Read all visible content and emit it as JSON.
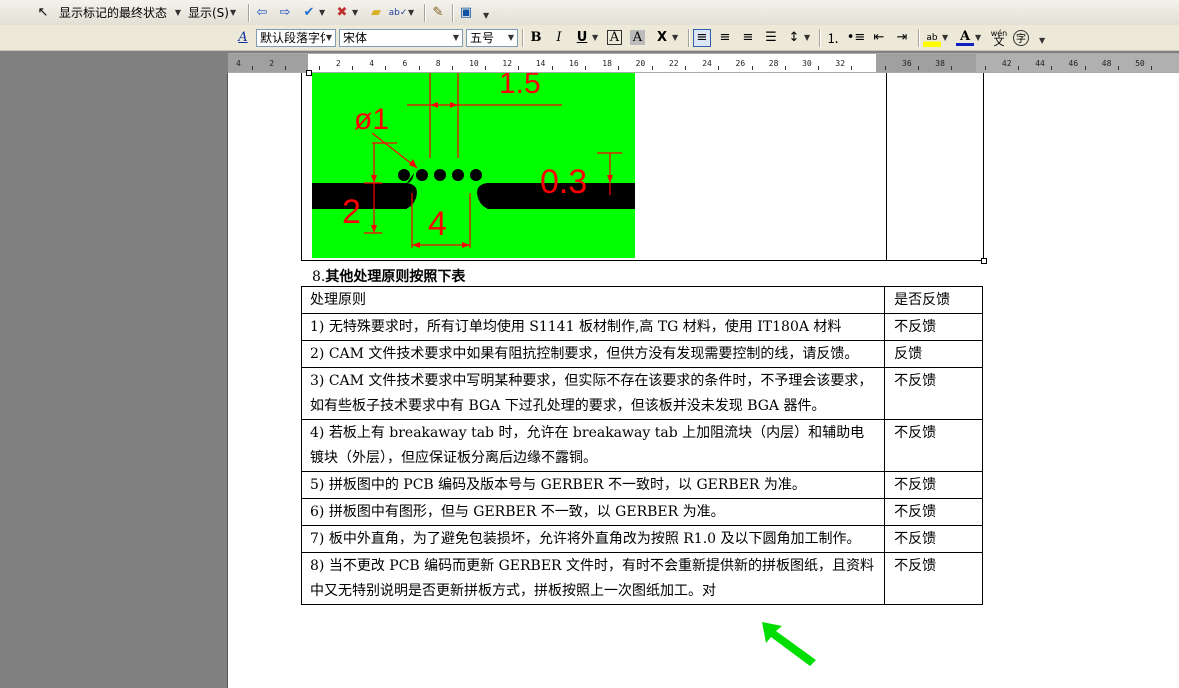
{
  "toolbar1": {
    "markup_state": "显示标记的最终状态",
    "show_label": "显示(S)"
  },
  "toolbar2": {
    "style": "默认段落字体",
    "font": "宋体",
    "size": "五号",
    "bold": "B",
    "italic": "I",
    "underline": "U",
    "char_border": "A",
    "char_shade": "A",
    "font_color": "A",
    "phonetic": "wén",
    "enclose": "字"
  },
  "ruler": {
    "ticks": [
      "4",
      "2",
      "",
      "2",
      "4",
      "6",
      "8",
      "10",
      "12",
      "14",
      "16",
      "18",
      "20",
      "22",
      "24",
      "26",
      "28",
      "30",
      "32",
      "",
      "36",
      "38",
      "",
      "42",
      "44",
      "46",
      "48",
      "50"
    ]
  },
  "diagram": {
    "labels": [
      "ø1",
      "1.5",
      "0.3",
      "2",
      "4"
    ]
  },
  "section": {
    "number": "8.",
    "title": "其他处理原则按照下表"
  },
  "table": {
    "headers": [
      "处理原则",
      "是否反馈"
    ],
    "rows": [
      {
        "rule": "1) 无特殊要求时，所有订单均使用 S1141 板材制作,高 TG 材料，使用 IT180A 材料",
        "feedback": "不反馈"
      },
      {
        "rule": "2) CAM 文件技术要求中如果有阻抗控制要求，但供方没有发现需要控制的线，请反馈。",
        "feedback": "反馈"
      },
      {
        "rule": "3) CAM 文件技术要求中写明某种要求，但实际不存在该要求的条件时，不予理会该要求，如有些板子技术要求中有 BGA 下过孔处理的要求，但该板并没未发现 BGA 器件。",
        "feedback": "不反馈"
      },
      {
        "rule": "4) 若板上有 breakaway tab 时，允许在 breakaway tab 上加阻流块（内层）和辅助电镀块（外层），但应保证板分离后边缘不露铜。",
        "feedback": "不反馈"
      },
      {
        "rule": "5) 拼板图中的 PCB 编码及版本号与 GERBER 不一致时，以 GERBER 为准。",
        "feedback": "不反馈"
      },
      {
        "rule": "6) 拼板图中有图形，但与 GERBER 不一致，以 GERBER 为准。",
        "feedback": "不反馈"
      },
      {
        "rule": "7) 板中外直角，为了避免包装损坏，允许将外直角改为按照 R1.0 及以下圆角加工制作。",
        "feedback": "不反馈"
      },
      {
        "rule": "8) 当不更改 PCB 编码而更新 GERBER 文件时，有时不会重新提供新的拼板图纸，且资料中又无特别说明是否更新拼板方式，拼板按照上一次图纸加工。对",
        "feedback": "不反馈"
      }
    ]
  },
  "colors": {
    "diagram_bg": "#00ff00",
    "arrow": "#00dd00",
    "dimension": "#ff0000"
  }
}
